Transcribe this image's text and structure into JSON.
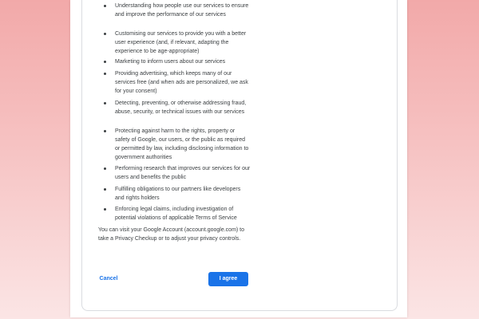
{
  "dialog": {
    "bullets": [
      "Understanding how people use our services to ensure and improve the performance of our services",
      "Customising our services to provide you with a better user experience (and, if relevant, adapting the experience to be age-appropriate)",
      "Marketing to inform users about our services",
      "Providing advertising, which keeps many of our services free (and when ads are personalized, we ask for your consent)",
      "Detecting, preventing, or otherwise addressing fraud, abuse, security, or technical issues with our services",
      "Protecting against harm to the rights, property or safety of Google, our users, or the public as required or permitted by law, including disclosing information to government authorities",
      "Performing research that improves our services for our users and benefits the public",
      "Fulfilling obligations to our partners like developers and rights holders",
      "Enforcing legal claims, including investigation of potential violations of applicable Terms of Service"
    ],
    "closing_text": "You can visit your Google Account (account.google.com) to take a Privacy Checkup or to adjust your privacy controls.",
    "cancel_label": "Cancel",
    "agree_label": "I agree"
  },
  "colors": {
    "background_top": "#f2a9a9",
    "background_bottom": "#fbe5e5",
    "accent": "#1a73e8",
    "text": "#3c4043"
  }
}
